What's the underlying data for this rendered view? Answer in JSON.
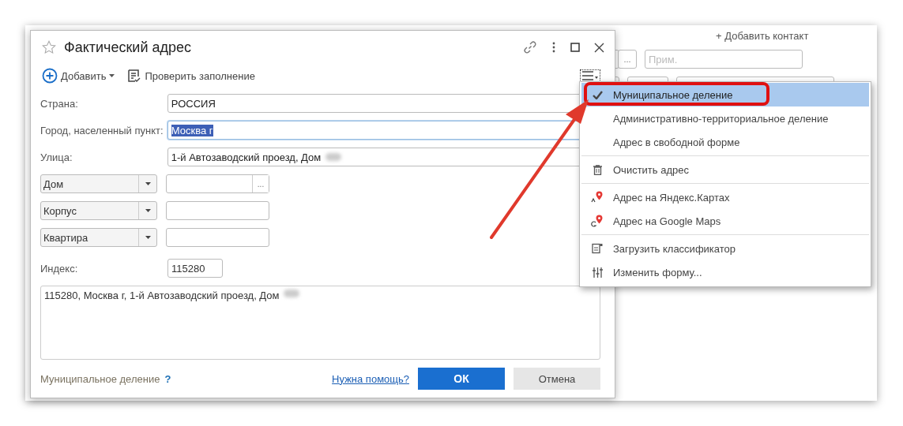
{
  "background_form": {
    "add_contact_link": "+ Добавить контакт",
    "select_button": "...",
    "note_field": {
      "placeholder": "Прим."
    }
  },
  "dialog": {
    "title": "Фактический адрес",
    "favorite": false,
    "toolbar": {
      "add_button": "Добавить",
      "check_button": "Проверить заполнение"
    },
    "fields": [
      {
        "label": "Страна:",
        "value": "РОССИЯ",
        "focused": false
      },
      {
        "label": "Город, населенный пункт:",
        "value": "Москва г",
        "focused": true
      },
      {
        "label": "Улица:",
        "value": "1-й Автозаводский проезд, Дом",
        "focused": false
      }
    ],
    "building_rows": [
      {
        "type": "Дом",
        "value": "",
        "select_button": "..."
      },
      {
        "type": "Корпус",
        "value": ""
      },
      {
        "type": "Квартира",
        "value": ""
      }
    ],
    "postcode": {
      "label": "Индекс:",
      "value": "115280"
    },
    "full_address": "115280, Москва г, 1-й Автозаводский проезд, Дом",
    "footer": {
      "mode_link": "Муниципальное деление",
      "help_mark": "?",
      "help_link": "Нужна помощь?",
      "ok_button": "ОК",
      "cancel_button": "Отмена"
    }
  },
  "menu": {
    "groups": [
      [
        {
          "label": "Муниципальное деление",
          "kind": "option",
          "checked": true,
          "selected": true
        },
        {
          "label": "Административно-территориальное деление",
          "kind": "option",
          "checked": false,
          "selected": false
        },
        {
          "label": "Адрес в свободной форме",
          "kind": "option",
          "checked": false,
          "selected": false
        }
      ],
      [
        {
          "label": "Очистить адрес",
          "kind": "action",
          "selected": false
        }
      ],
      [
        {
          "label": "Адрес на Яндекс.Картах",
          "kind": "action",
          "selected": false
        },
        {
          "label": "Адрес на Google Maps",
          "kind": "action",
          "selected": false
        }
      ],
      [
        {
          "label": "Загрузить классификатор",
          "kind": "action",
          "selected": false
        },
        {
          "label": "Изменить форму...",
          "kind": "action",
          "selected": false
        }
      ]
    ]
  }
}
